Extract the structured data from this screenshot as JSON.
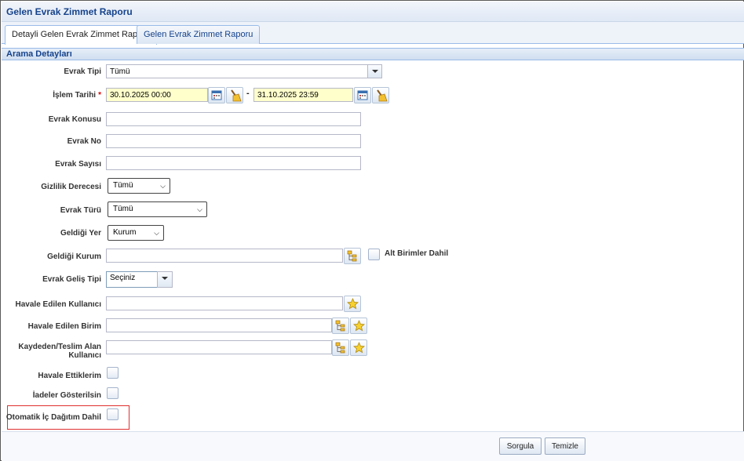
{
  "window": {
    "title": "Gelen Evrak Zimmet Raporu"
  },
  "tabs": [
    {
      "label": "Detayli Gelen Evrak Zimmet Raporu",
      "active": true
    },
    {
      "label": "Gelen Evrak Zimmet Raporu",
      "active": false
    }
  ],
  "section": {
    "title": "Arama Detayları"
  },
  "form": {
    "evrak_tipi": {
      "label": "Evrak Tipi",
      "value": "Tümü"
    },
    "islem_tarihi": {
      "label": "İşlem Tarihi",
      "required_mark": "*",
      "start": "30.10.2025 00:00",
      "separator": "-",
      "end": "31.10.2025 23:59"
    },
    "evrak_konusu": {
      "label": "Evrak Konusu",
      "value": ""
    },
    "evrak_no": {
      "label": "Evrak No",
      "value": ""
    },
    "evrak_sayisi": {
      "label": "Evrak Sayısı",
      "value": ""
    },
    "gizlilik_derecesi": {
      "label": "Gizlilik Derecesi",
      "value": "Tümü"
    },
    "evrak_turu": {
      "label": "Evrak Türü",
      "value": "Tümü"
    },
    "geldigi_yer": {
      "label": "Geldiği Yer",
      "value": "Kurum"
    },
    "geldigi_kurum": {
      "label": "Geldiği Kurum",
      "value": "",
      "checkbox_label": "Alt Birimler Dahil"
    },
    "evrak_gelis_tipi": {
      "label": "Evrak Geliş Tipi",
      "value": "Seçiniz"
    },
    "havale_edilen_kullanici": {
      "label": "Havale Edilen Kullanıcı",
      "value": ""
    },
    "havale_edilen_birim": {
      "label": "Havale Edilen Birim",
      "value": ""
    },
    "kaydeden_teslim_alan": {
      "label_line1": "Kaydeden/Teslim Alan",
      "label_line2": "Kullanıcı",
      "value": ""
    },
    "havale_ettiklerim": {
      "label": "Havale Ettiklerim",
      "checked": false
    },
    "iadeler": {
      "label": "İadeler Gösterilsin",
      "checked": false
    },
    "otomatik_ic_dagitim": {
      "label": "Otomatik İç Dağıtım Dahil",
      "checked": false,
      "highlight_color": "#e03030"
    }
  },
  "footer": {
    "query_label": "Sorgula",
    "clear_label": "Temizle"
  },
  "icons": {
    "calendar": "calendar-icon",
    "clear": "broom-icon",
    "tree": "tree-icon",
    "favorite": "star-icon"
  },
  "colors": {
    "header_text": "#15428b",
    "date_bg": "#ffffcc",
    "required": "#dd0000"
  }
}
